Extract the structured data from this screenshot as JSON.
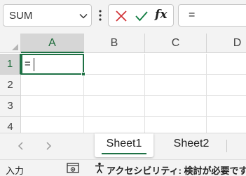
{
  "formula_bar": {
    "name_box": "SUM",
    "formula": "=",
    "fx_label": "fx"
  },
  "grid": {
    "columns": [
      "A",
      "B",
      "C",
      "D"
    ],
    "rows": [
      "1",
      "2",
      "3",
      "4"
    ],
    "active_cell_value": "="
  },
  "sheet_tabs": {
    "tabs": [
      "Sheet1",
      "Sheet2"
    ]
  },
  "status_bar": {
    "mode": "入力",
    "accessibility": "アクセシビリティ: 検討が必要です"
  },
  "colors": {
    "accent": "#1e7145",
    "cancel": "#d13438",
    "confirm": "#107c41"
  }
}
